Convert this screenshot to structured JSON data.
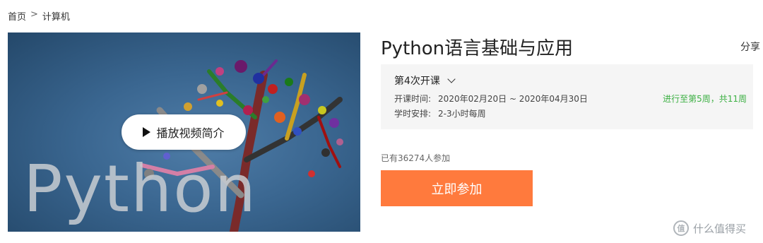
{
  "breadcrumb": {
    "home": "首页",
    "separator": ">",
    "category": "计算机"
  },
  "video": {
    "cover_word": "Python",
    "play_label": "播放视频简介"
  },
  "course": {
    "title": "Python语言基础与应用",
    "share_label": "分享"
  },
  "session": {
    "label": "第4次开课",
    "time_label": "开课时间:",
    "time_value": "2020年02月20日 ~ 2020年04月30日",
    "schedule_label": "学时安排:",
    "schedule_value": "2-3小时每周",
    "progress": "进行至第5周，共11周"
  },
  "enrollment": {
    "count_text": "已有36274人参加",
    "join_label": "立即参加"
  },
  "watermark": {
    "logo_text": "值",
    "text": "什么值得买"
  },
  "colors": {
    "accent": "#ff7a3d",
    "progress": "#3cb043",
    "box_bg": "#f5f5f5"
  }
}
